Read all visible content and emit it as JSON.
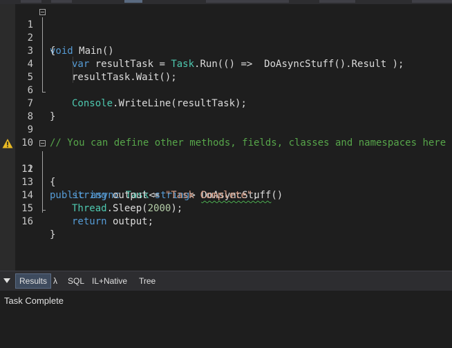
{
  "editor": {
    "lines": [
      {
        "num": "1"
      },
      {
        "num": "2"
      },
      {
        "num": "3"
      },
      {
        "num": "4"
      },
      {
        "num": "5"
      },
      {
        "num": "6"
      },
      {
        "num": "7"
      },
      {
        "num": "8"
      },
      {
        "num": "9"
      },
      {
        "num": "10"
      },
      {
        "num": "11"
      },
      {
        "num": "12"
      },
      {
        "num": "13"
      },
      {
        "num": "14"
      },
      {
        "num": "15"
      },
      {
        "num": "16"
      }
    ],
    "tokens": {
      "l1_void": "void",
      "l1_main": " Main()",
      "l2_brace": "{",
      "l3_var": "var",
      "l3_a": " resultTask = ",
      "l3_task": "Task",
      "l3_b": ".Run(() =>  DoAsyncStuff().Result );",
      "l4": "resultTask.Wait();",
      "l6_console": "Console",
      "l6_rest": ".WriteLine(resultTask);",
      "l7_brace": "}",
      "l9_comment": "// You can define other methods, fields, classes and namespaces here",
      "l11_public": "public",
      "l11_async": "async",
      "l11_task": "Task",
      "l11_lt": "<",
      "l11_string": "string",
      "l11_gt": ">",
      "l11_name": "DoAsyncStuff",
      "l11_paren": "()",
      "l12_brace": "{",
      "l13_string": "string",
      "l13_a": " output = ",
      "l13_str": "\"Task Complete\"",
      "l13_semi": ";",
      "l14_thread": "Thread",
      "l14_a": ".Sleep(",
      "l14_num": "2000",
      "l14_b": ");",
      "l15_return": "return",
      "l15_a": " output;",
      "l16_brace": "}"
    },
    "warning_icon": "warning-icon"
  },
  "results_panel": {
    "tabs": [
      "Results",
      "λ",
      "SQL",
      "IL+Native",
      "Tree"
    ],
    "active_tab": "Results",
    "output_text": "Task Complete"
  },
  "colors": {
    "background": "#1e1e1e",
    "keyword": "#569cd6",
    "type": "#4ec9b0",
    "string": "#d69d85",
    "number": "#b5cea8",
    "comment": "#57a64a",
    "warning": "#e8b923"
  }
}
